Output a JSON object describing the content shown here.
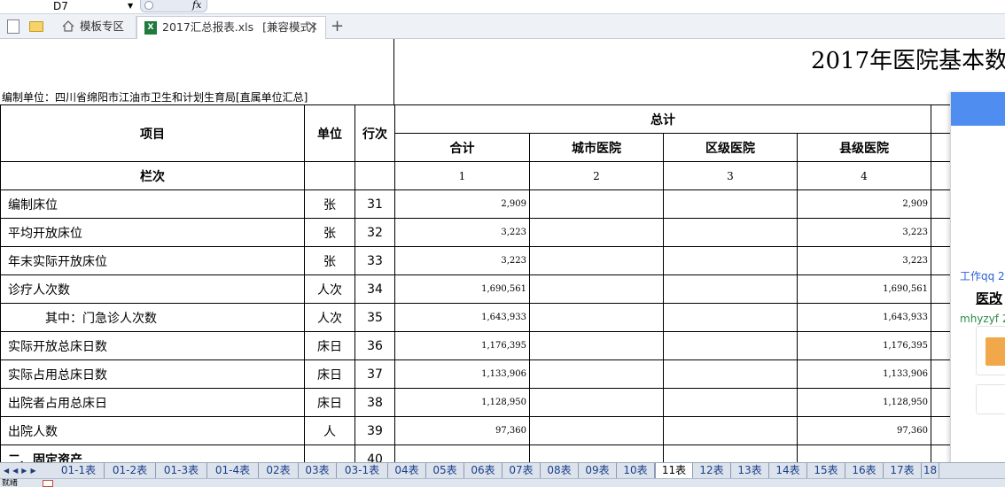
{
  "formula_bar": {
    "cell_ref": "D7",
    "fx_label": "fx"
  },
  "tabs": {
    "templates": "模板专区",
    "file": "2017汇总报表.xls",
    "mode": "[兼容模式]",
    "close": "✕",
    "add": "+"
  },
  "report": {
    "title": "2017年医院基本数",
    "compiler": "编制单位：四川省绵阳市江油市卫生和计划生育局[直属单位汇总]"
  },
  "table": {
    "headers": {
      "item": "项目",
      "unit": "单位",
      "line": "行次",
      "total": "总计",
      "sum": "合计",
      "city": "城市医院",
      "district": "区级医院",
      "county": "县级医院"
    },
    "col_row": {
      "label": "栏次",
      "nums": [
        "1",
        "2",
        "3",
        "4"
      ]
    },
    "rows": [
      {
        "item": "编制床位",
        "unit": "张",
        "line": "31",
        "sum": "2,909",
        "city": "",
        "district": "",
        "county": "2,909"
      },
      {
        "item": "平均开放床位",
        "unit": "张",
        "line": "32",
        "sum": "3,223",
        "city": "",
        "district": "",
        "county": "3,223"
      },
      {
        "item": "年末实际开放床位",
        "unit": "张",
        "line": "33",
        "sum": "3,223",
        "city": "",
        "district": "",
        "county": "3,223"
      },
      {
        "item": "诊疗人次数",
        "unit": "人次",
        "line": "34",
        "sum": "1,690,561",
        "city": "",
        "district": "",
        "county": "1,690,561"
      },
      {
        "item": "其中：门急诊人次数",
        "unit": "人次",
        "line": "35",
        "sum": "1,643,933",
        "city": "",
        "district": "",
        "county": "1,643,933"
      },
      {
        "item": "实际开放总床日数",
        "unit": "床日",
        "line": "36",
        "sum": "1,176,395",
        "city": "",
        "district": "",
        "county": "1,176,395"
      },
      {
        "item": "实际占用总床日数",
        "unit": "床日",
        "line": "37",
        "sum": "1,133,906",
        "city": "",
        "district": "",
        "county": "1,133,906"
      },
      {
        "item": "出院者占用总床日",
        "unit": "床日",
        "line": "38",
        "sum": "1,128,950",
        "city": "",
        "district": "",
        "county": "1,128,950"
      },
      {
        "item": "出院人数",
        "unit": "人",
        "line": "39",
        "sum": "97,360",
        "city": "",
        "district": "",
        "county": "97,360"
      },
      {
        "item": "二、固定资产",
        "unit": "",
        "line": "40",
        "sum": "",
        "city": "",
        "district": "",
        "county": ""
      }
    ]
  },
  "popup": {
    "link1": "工作qq 2",
    "title": "医改",
    "link2": "mhyzyf 2"
  },
  "sheet_tabs": [
    "01-1表",
    "01-2表",
    "01-3表",
    "01-4表",
    "02表",
    "03表",
    "03-1表",
    "04表",
    "05表",
    "06表",
    "07表",
    "08表",
    "09表",
    "10表",
    "11表",
    "12表",
    "13表",
    "14表",
    "15表",
    "16表",
    "17表",
    "18"
  ],
  "active_sheet": "11表",
  "nav_arrows": "◀◀▶▶",
  "status": "就绪"
}
